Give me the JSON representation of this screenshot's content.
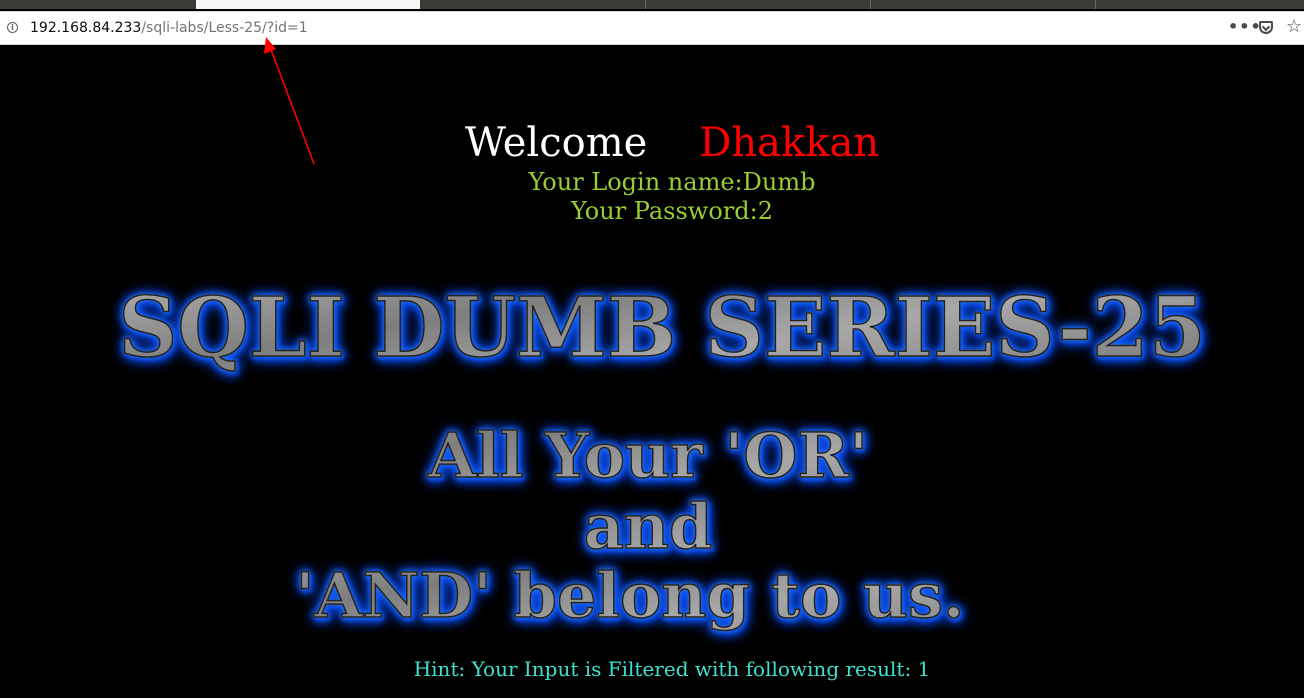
{
  "browser": {
    "url_host": "192.168.84.233",
    "url_path": "/sqli-labs/Less-25/?id=1",
    "page_actions_label": "•••",
    "star_glyph": "☆"
  },
  "page": {
    "welcome_label": "Welcome",
    "welcome_name": "Dhakkan",
    "login_line": "Your Login name:Dumb",
    "password_line": "Your Password:2",
    "banner_title": "SQLI DUMB SERIES-25",
    "slogan_line1": "All Your 'OR'",
    "slogan_line2": "and",
    "slogan_line3": "'AND' belong to us.",
    "hint": "Hint: Your Input is Filtered with following result: 1"
  },
  "colors": {
    "background": "#000000",
    "welcome": "#ffffff",
    "name": "#ff0000",
    "credentials": "#9acd32",
    "hint": "#40e0d0",
    "banner_glow": "#1e7bff",
    "annotation_arrow": "#ff0000"
  }
}
